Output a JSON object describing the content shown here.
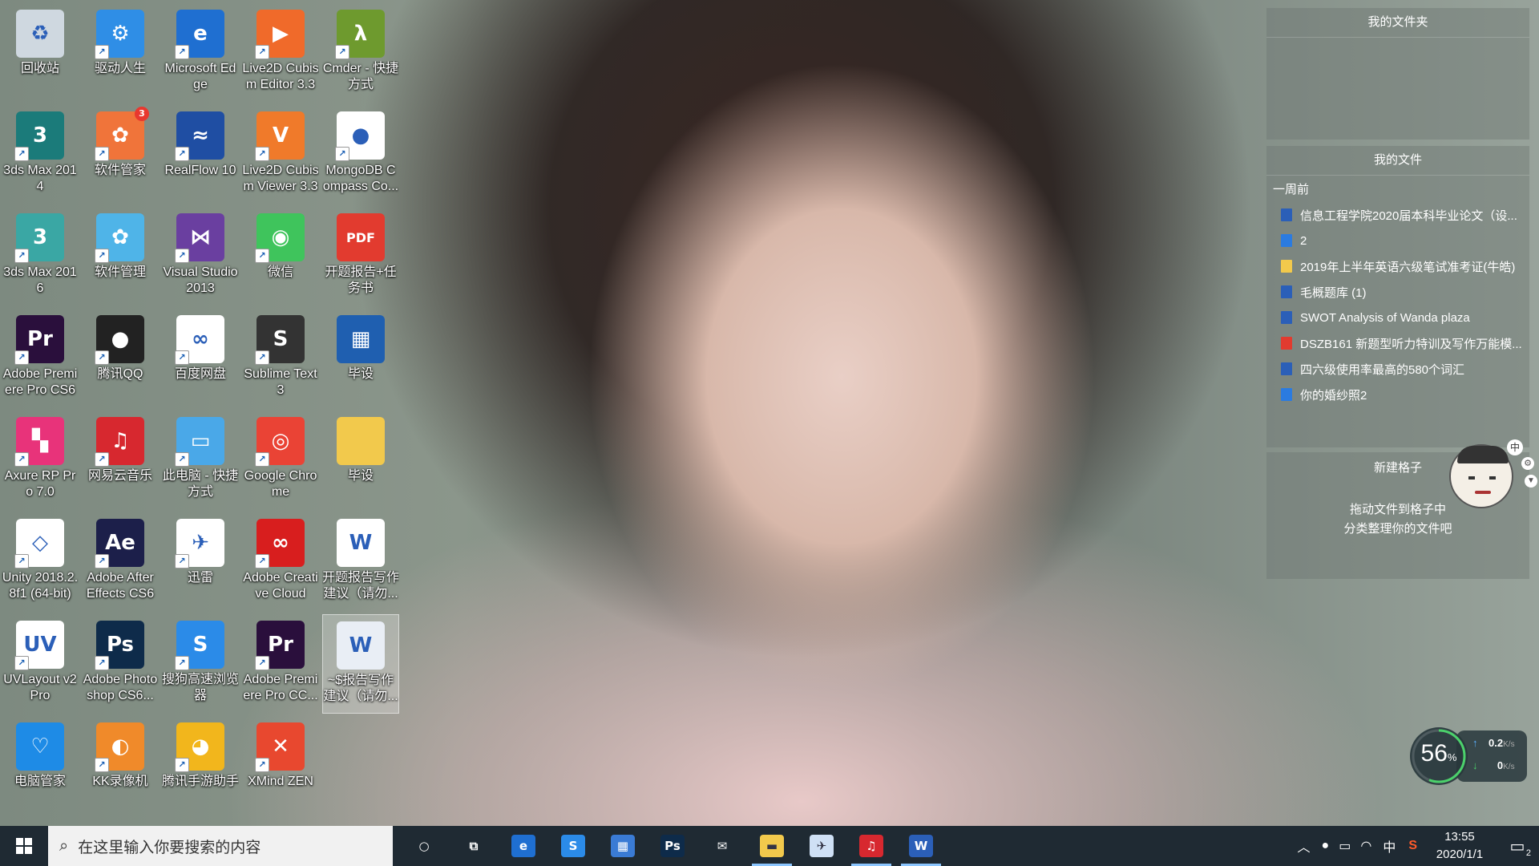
{
  "desktop_icons": [
    {
      "label": "回收站",
      "icon": "recycle-bin-icon",
      "color": "#cfd8e0",
      "glyph": "♻",
      "shortcut": false
    },
    {
      "label": "驱动人生",
      "icon": "gear-icon",
      "color": "#2f8ee6",
      "glyph": "⚙",
      "shortcut": true
    },
    {
      "label": "Microsoft Edge",
      "icon": "edge-icon",
      "color": "#1f6fd1",
      "glyph": "e",
      "shortcut": true
    },
    {
      "label": "Live2D Cubism Editor 3.3",
      "icon": "live2d-editor-icon",
      "color": "#f06a2a",
      "glyph": "▶",
      "shortcut": true
    },
    {
      "label": "Cmder - 快捷方式",
      "icon": "cmder-icon",
      "color": "#6e9a2e",
      "glyph": "λ",
      "shortcut": true
    },
    {
      "label": "3ds Max 2014",
      "icon": "3dsmax-icon",
      "color": "#1b7b7a",
      "glyph": "3",
      "shortcut": true
    },
    {
      "label": "软件管家",
      "icon": "software-manager-icon",
      "color": "#f0743a",
      "glyph": "✿",
      "shortcut": true,
      "badge": "3"
    },
    {
      "label": "RealFlow 10",
      "icon": "realflow-icon",
      "color": "#1f4ea3",
      "glyph": "≈",
      "shortcut": true
    },
    {
      "label": "Live2D Cubism Viewer 3.3",
      "icon": "live2d-viewer-icon",
      "color": "#f07a2a",
      "glyph": "V",
      "shortcut": true
    },
    {
      "label": "MongoDB Compass Co...",
      "icon": "mongodb-icon",
      "color": "#ffffff",
      "glyph": "●",
      "shortcut": true
    },
    {
      "label": "3ds Max 2016",
      "icon": "3dsmax-icon",
      "color": "#3aa7a4",
      "glyph": "3",
      "shortcut": true
    },
    {
      "label": "软件管理",
      "icon": "software-manage-icon",
      "color": "#4fb4e8",
      "glyph": "✿",
      "shortcut": true
    },
    {
      "label": "Visual Studio 2013",
      "icon": "visual-studio-icon",
      "color": "#6a3fa0",
      "glyph": "⋈",
      "shortcut": true
    },
    {
      "label": "微信",
      "icon": "wechat-icon",
      "color": "#3fc45c",
      "glyph": "◉",
      "shortcut": true
    },
    {
      "label": "开题报告+任务书",
      "icon": "pdf-icon",
      "color": "#e23b2f",
      "glyph": "PDF",
      "shortcut": false
    },
    {
      "label": "Adobe Premiere Pro CS6",
      "icon": "premiere-icon",
      "color": "#2a0f3c",
      "glyph": "Pr",
      "shortcut": true
    },
    {
      "label": "腾讯QQ",
      "icon": "qq-icon",
      "color": "#222222",
      "glyph": "●",
      "shortcut": true
    },
    {
      "label": "百度网盘",
      "icon": "baidu-netdisk-icon",
      "color": "#ffffff",
      "glyph": "∞",
      "shortcut": true
    },
    {
      "label": "Sublime Text 3",
      "icon": "sublime-icon",
      "color": "#333333",
      "glyph": "S",
      "shortcut": true
    },
    {
      "label": "毕设",
      "icon": "archive-icon",
      "color": "#1f5fb0",
      "glyph": "▦",
      "shortcut": false
    },
    {
      "label": "Axure RP Pro 7.0",
      "icon": "axure-icon",
      "color": "#e8337a",
      "glyph": "▚",
      "shortcut": true
    },
    {
      "label": "网易云音乐",
      "icon": "netease-music-icon",
      "color": "#d7282f",
      "glyph": "♫",
      "shortcut": true
    },
    {
      "label": "此电脑 - 快捷方式",
      "icon": "computer-icon",
      "color": "#4aa8e8",
      "glyph": "▭",
      "shortcut": true
    },
    {
      "label": "Google Chrome",
      "icon": "chrome-icon",
      "color": "#ea4335",
      "glyph": "◎",
      "shortcut": true
    },
    {
      "label": "毕设",
      "icon": "folder-icon",
      "color": "#f2c94c",
      "glyph": "",
      "shortcut": false
    },
    {
      "label": "Unity 2018.2.8f1 (64-bit)",
      "icon": "unity-icon",
      "color": "#ffffff",
      "glyph": "◇",
      "shortcut": true
    },
    {
      "label": "Adobe After Effects CS6",
      "icon": "after-effects-icon",
      "color": "#1c1f4a",
      "glyph": "Ae",
      "shortcut": true
    },
    {
      "label": "迅雷",
      "icon": "thunder-icon",
      "color": "#ffffff",
      "glyph": "✈",
      "shortcut": true
    },
    {
      "label": "Adobe Creative Cloud",
      "icon": "creative-cloud-icon",
      "color": "#d81e1e",
      "glyph": "∞",
      "shortcut": true
    },
    {
      "label": "开题报告写作建议（请勿...",
      "icon": "word-doc-icon",
      "color": "#ffffff",
      "glyph": "W",
      "shortcut": false
    },
    {
      "label": "UVLayout v2 Pro",
      "icon": "uvlayout-icon",
      "color": "#ffffff",
      "glyph": "UV",
      "shortcut": true
    },
    {
      "label": "Adobe Photoshop CS6...",
      "icon": "photoshop-icon",
      "color": "#0e2b4a",
      "glyph": "Ps",
      "shortcut": true
    },
    {
      "label": "搜狗高速浏览器",
      "icon": "sogou-browser-icon",
      "color": "#2b8be8",
      "glyph": "S",
      "shortcut": true
    },
    {
      "label": "Adobe Premiere Pro CC...",
      "icon": "premiere-icon",
      "color": "#2a0f3c",
      "glyph": "Pr",
      "shortcut": true
    },
    {
      "label": "~$报告写作建议（请勿...",
      "icon": "word-doc-icon",
      "color": "#e9eef5",
      "glyph": "W",
      "shortcut": false,
      "selected": true
    },
    {
      "label": "电脑管家",
      "icon": "pc-manager-icon",
      "color": "#1e8be6",
      "glyph": "♡",
      "shortcut": false
    },
    {
      "label": "KK录像机",
      "icon": "kk-recorder-icon",
      "color": "#f08a2a",
      "glyph": "◐",
      "shortcut": true
    },
    {
      "label": "腾讯手游助手",
      "icon": "mobile-game-assistant-icon",
      "color": "#f2b61c",
      "glyph": "◕",
      "shortcut": true
    },
    {
      "label": "XMind ZEN",
      "icon": "xmind-icon",
      "color": "#e8482f",
      "glyph": "✕",
      "shortcut": true
    }
  ],
  "fences": {
    "folder": {
      "title": "我的文件夹"
    },
    "files": {
      "title": "我的文件",
      "group": "一周前",
      "items": [
        {
          "name": "信息工程学院2020届本科毕业论文（设...",
          "icon": "word-doc-icon",
          "color": "#2b5fb8"
        },
        {
          "name": "2",
          "icon": "document-icon",
          "color": "#2b7be0"
        },
        {
          "name": "2019年上半年英语六级笔试准考证(牛皓)",
          "icon": "folder-icon",
          "color": "#f2c94c"
        },
        {
          "name": "毛概题库 (1)",
          "icon": "word-doc-icon",
          "color": "#2b5fb8"
        },
        {
          "name": "SWOT Analysis of Wanda plaza",
          "icon": "word-doc-icon",
          "color": "#2b5fb8"
        },
        {
          "name": "DSZB161 新题型听力特训及写作万能模...",
          "icon": "pdf-icon",
          "color": "#e23b2f"
        },
        {
          "name": "四六级使用率最高的580个词汇",
          "icon": "word-doc-icon",
          "color": "#2b5fb8"
        },
        {
          "name": "你的婚纱照2",
          "icon": "document-icon",
          "color": "#2b7be0"
        }
      ]
    },
    "new": {
      "title": "新建格子",
      "hint_line1": "拖动文件到格子中",
      "hint_line2": "分类整理你的文件吧"
    }
  },
  "floating_mascot": {
    "ime_char": "中"
  },
  "net_meter": {
    "percent_label": "56",
    "percent_unit": "%",
    "up": "0.2",
    "up_unit": "K/s",
    "down": "0",
    "down_unit": "K/s",
    "percent_value": 56
  },
  "taskbar": {
    "search_placeholder": "在这里输入你要搜索的内容",
    "apps": [
      {
        "name": "cortana",
        "icon": "cortana-icon",
        "glyph": "○",
        "color": "transparent",
        "active": false
      },
      {
        "name": "task-view",
        "icon": "task-view-icon",
        "glyph": "⧉",
        "color": "transparent",
        "active": false
      },
      {
        "name": "edge",
        "icon": "edge-icon",
        "glyph": "e",
        "color": "#1f6fd1",
        "active": false
      },
      {
        "name": "sogou-browser",
        "icon": "sogou-browser-icon",
        "glyph": "S",
        "color": "#2b8be8",
        "active": false
      },
      {
        "name": "store",
        "icon": "store-icon",
        "glyph": "▦",
        "color": "#3a7bd5",
        "active": false
      },
      {
        "name": "photoshop",
        "icon": "photoshop-icon",
        "glyph": "Ps",
        "color": "#0e2b4a",
        "active": false
      },
      {
        "name": "mail",
        "icon": "mail-icon",
        "glyph": "✉",
        "color": "transparent",
        "active": false
      },
      {
        "name": "file-explorer",
        "icon": "folder-icon",
        "glyph": "▬",
        "color": "#f2c94c",
        "active": true
      },
      {
        "name": "thunder",
        "icon": "thunder-icon",
        "glyph": "✈",
        "color": "#cfe0f5",
        "active": false
      },
      {
        "name": "netease-music",
        "icon": "netease-music-icon",
        "glyph": "♫",
        "color": "#d7282f",
        "active": true
      },
      {
        "name": "word",
        "icon": "word-icon",
        "glyph": "W",
        "color": "#2b5fb8",
        "active": true
      }
    ],
    "tray": {
      "ime": "中",
      "time": "13:55",
      "date": "2020/1/1",
      "notifications": "2"
    }
  }
}
